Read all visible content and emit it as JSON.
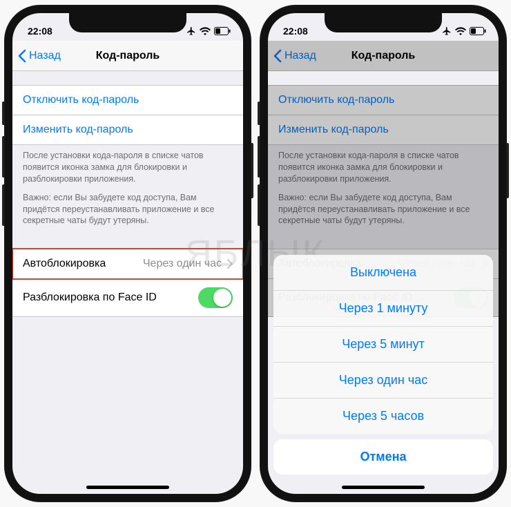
{
  "status": {
    "time": "22:08"
  },
  "nav": {
    "back": "Назад",
    "title": "Код-пароль"
  },
  "links": {
    "disable": "Отключить код-пароль",
    "change": "Изменить код-пароль"
  },
  "notes": {
    "p1": "После установки кода-пароля в списке чатов появится иконка замка для блокировки и разблокировки приложения.",
    "p2": "Важно: если Вы забудете код доступа, Вам придётся переустанавливать приложение и все секретные чаты будут утеряны."
  },
  "cells": {
    "autolock_label": "Автоблокировка",
    "autolock_value": "Через один час",
    "faceid_label": "Разблокировка по Face ID"
  },
  "sheet": {
    "options": {
      "0": "Выключена",
      "1": "Через 1 минуту",
      "2": "Через 5 минут",
      "3": "Через один час",
      "4": "Через 5 часов"
    },
    "cancel": "Отмена"
  },
  "watermark": "ЯБЛЫК"
}
